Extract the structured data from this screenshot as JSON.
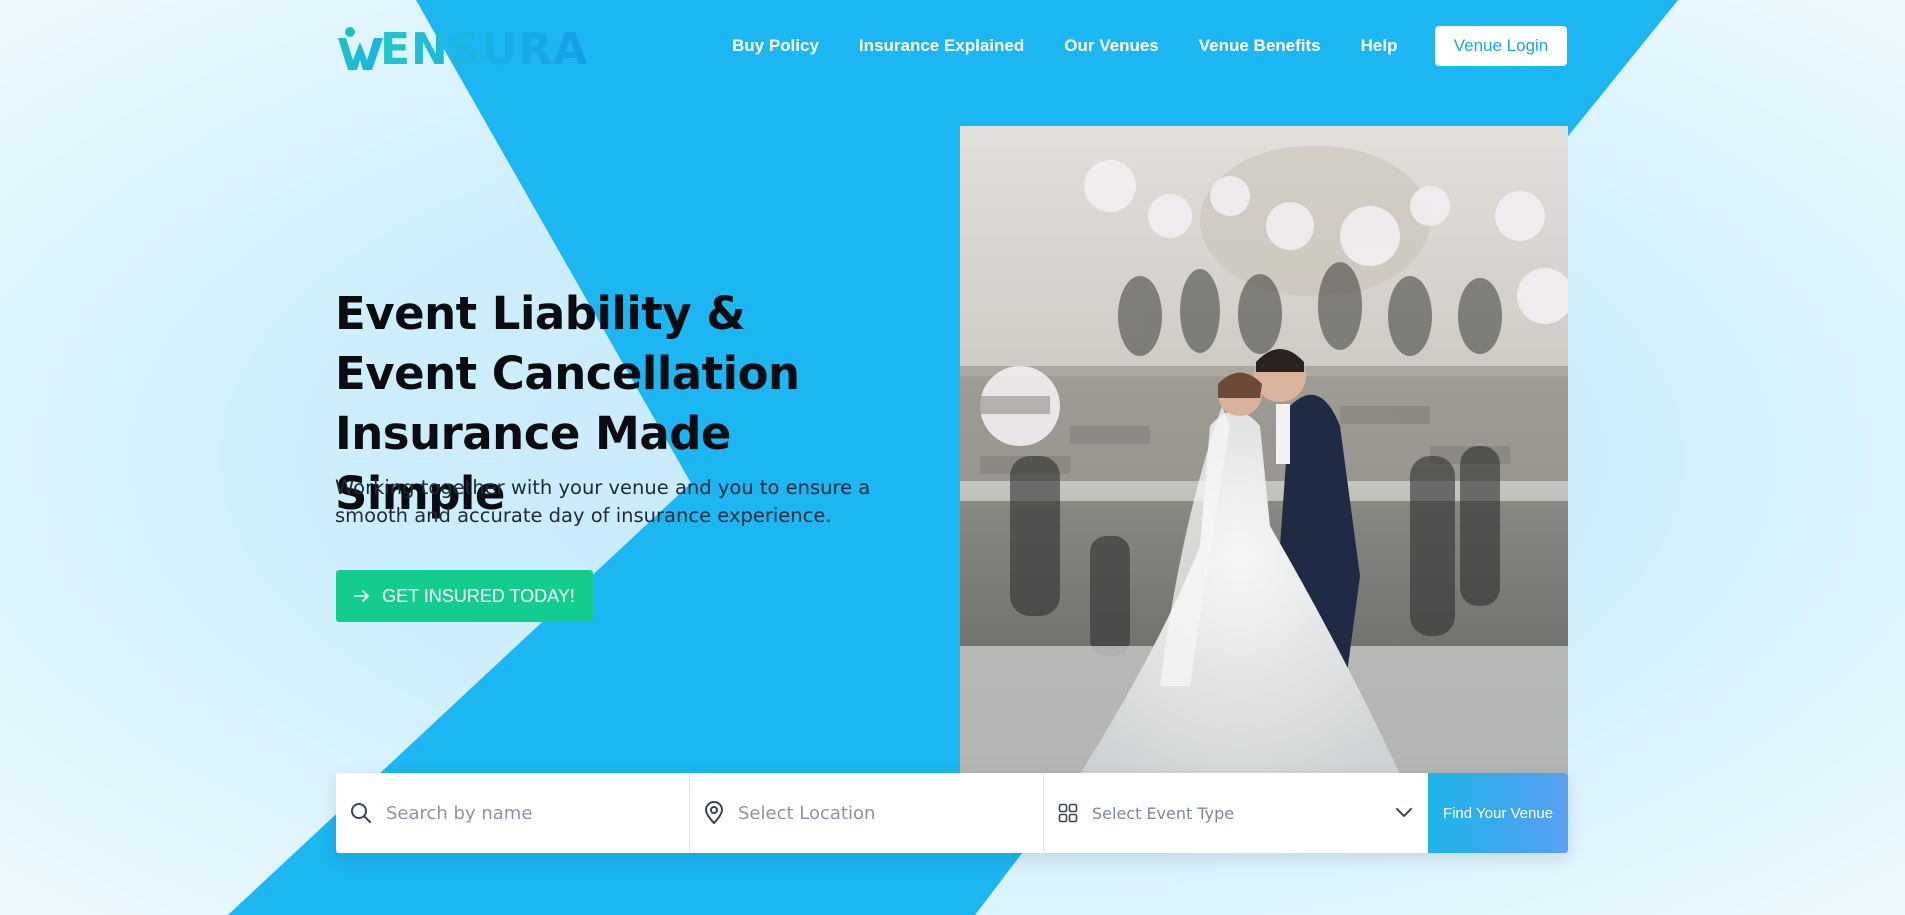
{
  "brand": {
    "logo_text": "ENSURA",
    "logo_letter": "W"
  },
  "nav": {
    "items": [
      {
        "label": "Buy Policy"
      },
      {
        "label": "Insurance Explained"
      },
      {
        "label": "Our Venues"
      },
      {
        "label": "Venue Benefits"
      },
      {
        "label": "Help"
      }
    ],
    "login_label": "Venue Login"
  },
  "hero": {
    "title": "Event Liability & Event Cancellation Insurance Made Simple",
    "subtitle": "Working together with your venue and you to ensure a smooth and accurate day of insurance experience.",
    "cta_label": "GET INSURED TODAY!"
  },
  "search": {
    "name_placeholder": "Search by name",
    "location_placeholder": "Select Location",
    "event_type_label": "Select Event Type",
    "button_label": "Find Your Venue"
  },
  "colors": {
    "primary_blue": "#1cb6f2",
    "cta_green": "#13cd8e",
    "logo_teal": "#20c7c7"
  },
  "icons": {
    "search": "search-icon",
    "location": "map-pin-icon",
    "event_type": "grid-icon",
    "chevron": "chevron-down-icon",
    "cta_arrow": "arrow-right-icon"
  }
}
